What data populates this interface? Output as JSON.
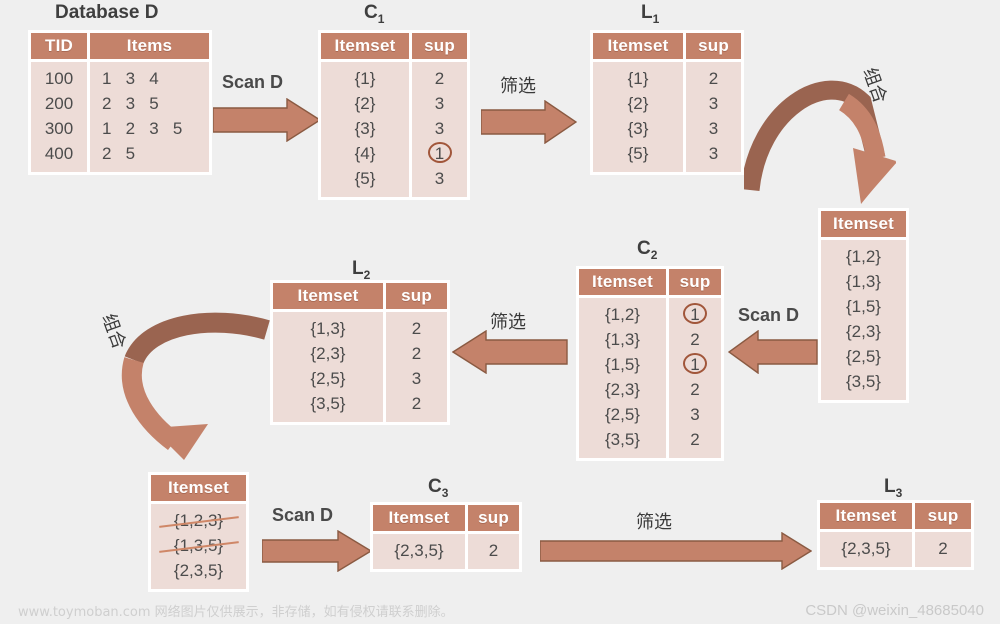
{
  "diagram": {
    "title": "Apriori algorithm frequent itemset generation",
    "colors": {
      "background": "#efefef",
      "header": "#c4826a",
      "cell": "#eddcd7",
      "arrow_fill": "#c4826a",
      "arrow_stroke": "#8a5a42",
      "curve_dark": "#9a6450",
      "circle_mark": "#a1563a",
      "strike": "#cf8767"
    }
  },
  "database": {
    "caption": "Database D",
    "columns": [
      "TID",
      "Items"
    ],
    "rows": [
      {
        "tid": "100",
        "items": "1   3   4"
      },
      {
        "tid": "200",
        "items": "2   3   5"
      },
      {
        "tid": "300",
        "items": "1   2   3   5"
      },
      {
        "tid": "400",
        "items": "2   5"
      }
    ]
  },
  "c1": {
    "caption": "C",
    "caption_sub": "1",
    "columns": [
      "Itemset",
      "sup"
    ],
    "rows": [
      {
        "itemset": "{1}",
        "sup": "2",
        "circled": false
      },
      {
        "itemset": "{2}",
        "sup": "3",
        "circled": false
      },
      {
        "itemset": "{3}",
        "sup": "3",
        "circled": false
      },
      {
        "itemset": "{4}",
        "sup": "1",
        "circled": true
      },
      {
        "itemset": "{5}",
        "sup": "3",
        "circled": false
      }
    ]
  },
  "l1": {
    "caption": "L",
    "caption_sub": "1",
    "columns": [
      "Itemset",
      "sup"
    ],
    "rows": [
      {
        "itemset": "{1}",
        "sup": "2"
      },
      {
        "itemset": "{2}",
        "sup": "3"
      },
      {
        "itemset": "{3}",
        "sup": "3"
      },
      {
        "itemset": "{5}",
        "sup": "3"
      }
    ]
  },
  "c2_candidates": {
    "columns": [
      "Itemset"
    ],
    "rows": [
      {
        "itemset": "{1,2}"
      },
      {
        "itemset": "{1,3}"
      },
      {
        "itemset": "{1,5}"
      },
      {
        "itemset": "{2,3}"
      },
      {
        "itemset": "{2,5}"
      },
      {
        "itemset": "{3,5}"
      }
    ]
  },
  "c2": {
    "caption": "C",
    "caption_sub": "2",
    "columns": [
      "Itemset",
      "sup"
    ],
    "rows": [
      {
        "itemset": "{1,2}",
        "sup": "1",
        "circled": true
      },
      {
        "itemset": "{1,3}",
        "sup": "2",
        "circled": false
      },
      {
        "itemset": "{1,5}",
        "sup": "1",
        "circled": true
      },
      {
        "itemset": "{2,3}",
        "sup": "2",
        "circled": false
      },
      {
        "itemset": "{2,5}",
        "sup": "3",
        "circled": false
      },
      {
        "itemset": "{3,5}",
        "sup": "2",
        "circled": false
      }
    ]
  },
  "l2": {
    "caption": "L",
    "caption_sub": "2",
    "columns": [
      "Itemset",
      "sup"
    ],
    "rows": [
      {
        "itemset": "{1,3}",
        "sup": "2"
      },
      {
        "itemset": "{2,3}",
        "sup": "2"
      },
      {
        "itemset": "{2,5}",
        "sup": "3"
      },
      {
        "itemset": "{3,5}",
        "sup": "2"
      }
    ]
  },
  "c3_candidates": {
    "columns": [
      "Itemset"
    ],
    "rows": [
      {
        "itemset": "{1,2,3}",
        "struck": true
      },
      {
        "itemset": "{1,3,5}",
        "struck": true
      },
      {
        "itemset": "{2,3,5}",
        "struck": false
      }
    ]
  },
  "c3": {
    "caption": "C",
    "caption_sub": "3",
    "columns": [
      "Itemset",
      "sup"
    ],
    "rows": [
      {
        "itemset": "{2,3,5}",
        "sup": "2"
      }
    ]
  },
  "l3": {
    "caption": "L",
    "caption_sub": "3",
    "columns": [
      "Itemset",
      "sup"
    ],
    "rows": [
      {
        "itemset": "{2,3,5}",
        "sup": "2"
      }
    ]
  },
  "arrows": {
    "scan_d_1": "Scan D",
    "filter_1": "筛选",
    "combine_1": "组合",
    "scan_d_2": "Scan D",
    "filter_2": "筛选",
    "combine_2": "组合",
    "scan_d_3": "Scan D",
    "filter_3": "筛选"
  },
  "watermarks": {
    "bottom_left": "www.toymoban.com 网络图片仅供展示，非存储，如有侵权请联系删除。",
    "bottom_right": "CSDN @weixin_48685040"
  }
}
